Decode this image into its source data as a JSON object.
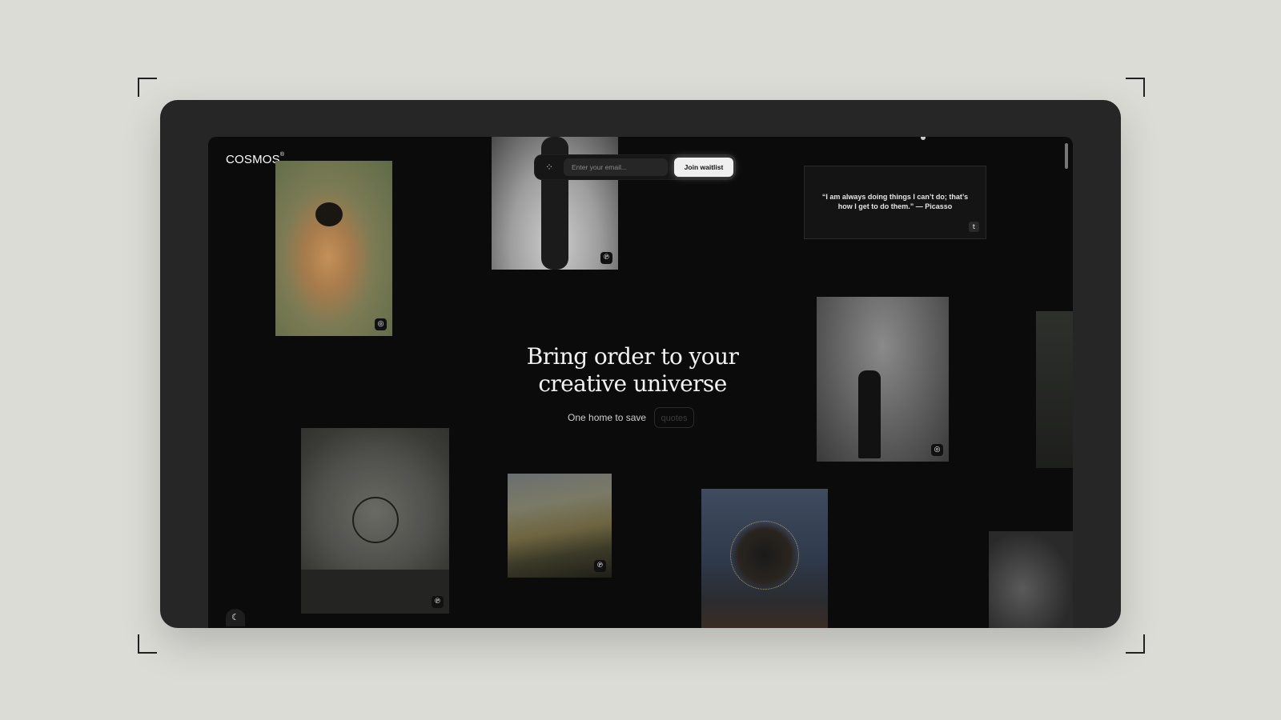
{
  "brand": {
    "name": "COSMOS",
    "mark": "®"
  },
  "waitlist": {
    "email_placeholder": "Enter your email...",
    "button_label": "Join waitlist",
    "icon": "sparkle-icon"
  },
  "hero": {
    "title_line1": "Bring order to your",
    "title_line2": "creative universe",
    "subtitle": "One home to save",
    "rotating_word": "quotes"
  },
  "quote_card": {
    "text": "“I am always doing things I can’t do; that’s how I get to do them.” — Picasso",
    "source_icon": "twitter-icon"
  },
  "cards": [
    {
      "name": "figure-photo",
      "source_icon": "instagram-icon",
      "glyph": "◎"
    },
    {
      "name": "hair-photo",
      "source_icon": "pinterest-icon",
      "glyph": "℗"
    },
    {
      "name": "circle-photo",
      "source_icon": "pinterest-icon",
      "glyph": "℗"
    },
    {
      "name": "hills-photo",
      "source_icon": "pinterest-icon",
      "glyph": "℗"
    },
    {
      "name": "veil-photo",
      "source_icon": "instagram-icon",
      "glyph": "◎"
    }
  ],
  "theme_toggle": {
    "icon": "moon-icon",
    "glyph": "☾"
  },
  "colors": {
    "page_bg": "#0b0b0b",
    "frame": "#262626",
    "backdrop": "#dcdcd7",
    "accent_button": "#efefef"
  }
}
